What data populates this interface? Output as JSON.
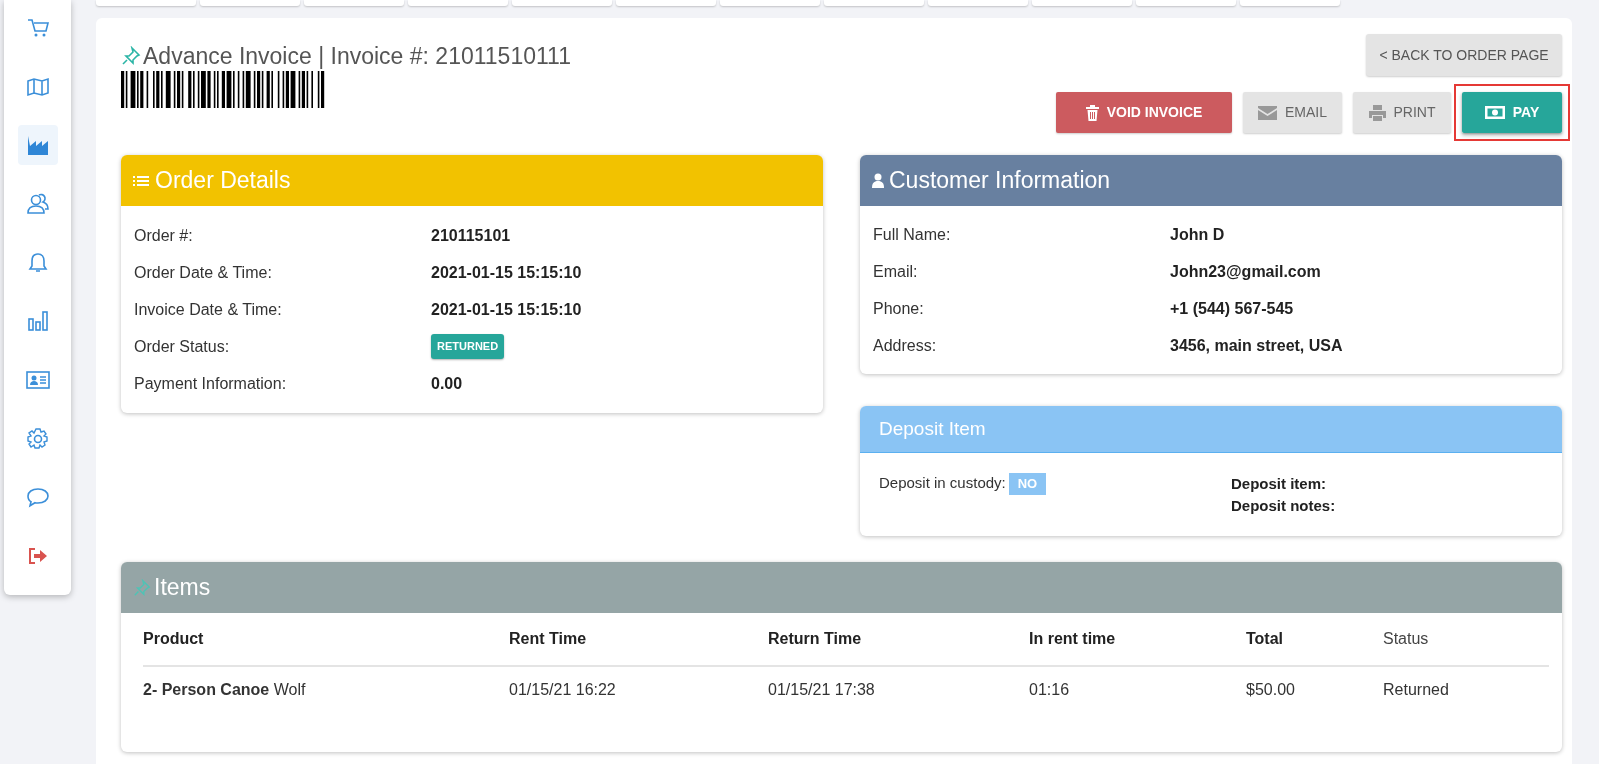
{
  "sidebar": {
    "items": [
      {
        "kind": "cart",
        "selected": false
      },
      {
        "kind": "map",
        "selected": false
      },
      {
        "kind": "area-chart",
        "selected": true
      },
      {
        "kind": "users",
        "selected": false
      },
      {
        "kind": "bell",
        "selected": false
      },
      {
        "kind": "bar-chart",
        "selected": false
      },
      {
        "kind": "id-card",
        "selected": false
      },
      {
        "kind": "gear",
        "selected": false
      },
      {
        "kind": "chat",
        "selected": false
      },
      {
        "kind": "logout",
        "selected": false
      }
    ]
  },
  "header": {
    "title": "Advance Invoice | Invoice #: 21011510111",
    "back_button": "< BACK TO ORDER PAGE"
  },
  "actions": [
    {
      "kind": "void",
      "label": "VOID INVOICE",
      "highlighted": false
    },
    {
      "kind": "email",
      "label": "EMAIL",
      "highlighted": false
    },
    {
      "kind": "print",
      "label": "PRINT",
      "highlighted": false
    },
    {
      "kind": "pay",
      "label": "PAY",
      "highlighted": true
    }
  ],
  "order_details": {
    "title": "Order Details",
    "rows": [
      {
        "kind": "text",
        "label": "Order #:",
        "value": "210115101"
      },
      {
        "kind": "text",
        "label": "Order Date & Time:",
        "value": "2021-01-15 15:15:10"
      },
      {
        "kind": "text",
        "label": "Invoice Date & Time:",
        "value": "2021-01-15 15:15:10"
      },
      {
        "kind": "badge",
        "label": "Order Status:",
        "value": "RETURNED"
      },
      {
        "kind": "text",
        "label": "Payment Information:",
        "value": "0.00"
      }
    ]
  },
  "customer": {
    "title": "Customer Information",
    "rows": [
      {
        "label": "Full Name:",
        "value": "John D"
      },
      {
        "label": "Email:",
        "value": "John23@gmail.com"
      },
      {
        "label": "Phone:",
        "value": "+1 (544) 567-545"
      },
      {
        "label": "Address:",
        "value": "3456, main street, USA"
      }
    ]
  },
  "deposit": {
    "title": "Deposit Item",
    "custody_label": "Deposit in custody:",
    "custody_value": "NO",
    "fields": [
      "Deposit item:",
      "Deposit notes:"
    ]
  },
  "items": {
    "title": "Items",
    "columns": [
      "Product",
      "Rent Time",
      "Return Time",
      "In rent time",
      "Total",
      "Status"
    ],
    "rows": [
      [
        "**2- Person Canoe** Wolf",
        "01/15/21 16:22",
        "01/15/21 17:38",
        "01:16",
        "$50.00",
        "Returned"
      ]
    ]
  }
}
